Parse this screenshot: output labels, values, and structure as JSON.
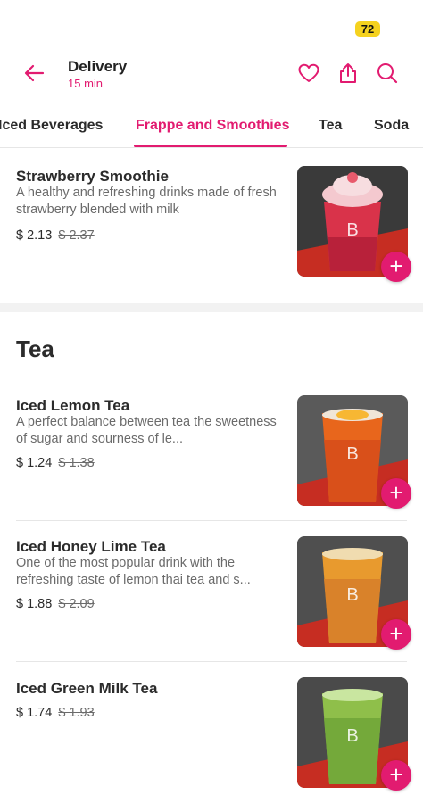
{
  "status": {
    "battery": "72"
  },
  "header": {
    "title": "Delivery",
    "subtitle": "15 min"
  },
  "tabs": [
    {
      "label": "Iced Beverages",
      "active": false
    },
    {
      "label": "Frappe and Smoothies",
      "active": true
    },
    {
      "label": "Tea",
      "active": false
    },
    {
      "label": "Soda",
      "active": false
    }
  ],
  "items": [
    {
      "name": "Strawberry Smoothie",
      "description": "A healthy and refreshing drinks made of fresh strawberry blended with milk",
      "price": "$ 2.13",
      "old_price": "$ 2.37"
    }
  ],
  "section_title": "Tea",
  "tea_items": [
    {
      "name": "Iced Lemon Tea",
      "description": "A perfect balance between tea the sweetness of sugar and sourness of le...",
      "price": "$ 1.24",
      "old_price": "$ 1.38"
    },
    {
      "name": "Iced Honey Lime Tea",
      "description": "One of the most popular drink with the refreshing taste of lemon thai tea and s...",
      "price": "$ 1.88",
      "old_price": "$ 2.09"
    },
    {
      "name": "Iced Green Milk Tea",
      "price": "$ 1.74",
      "old_price": "$ 1.93"
    }
  ],
  "add_label": "+",
  "colors": {
    "accent": "#e21b70",
    "battery": "#f5d21f"
  }
}
